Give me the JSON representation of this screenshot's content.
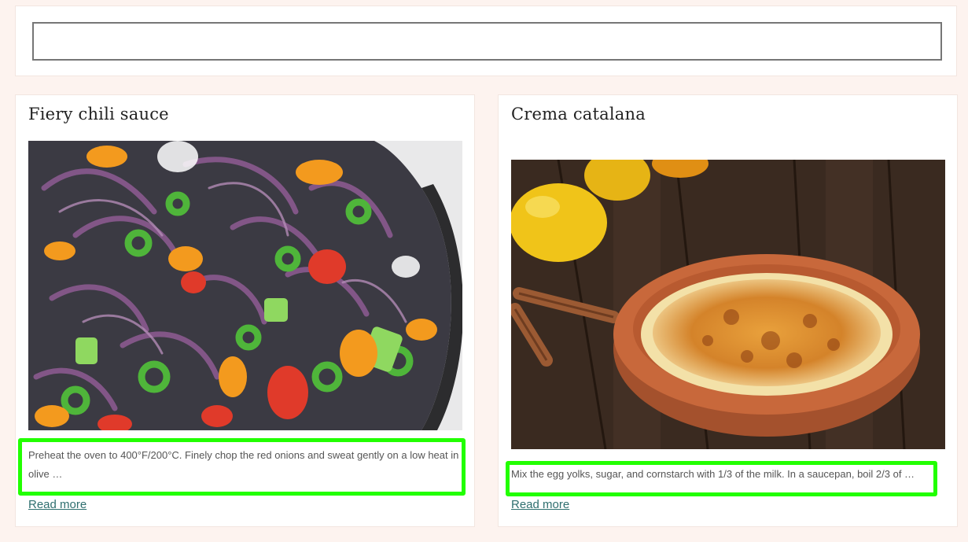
{
  "search": {
    "value": "",
    "placeholder": ""
  },
  "recipes": [
    {
      "title": "Fiery chili sauce",
      "image": "chili-sauce-photo",
      "excerpt": "Preheat the oven to 400°F/200°C. Finely chop the red onions and sweat gently on a low heat in olive …",
      "read_more": "Read more"
    },
    {
      "title": "Crema catalana",
      "image": "crema-catalana-photo",
      "excerpt": "Mix the egg yolks, sugar, and cornstarch with 1/3 of the milk. In a saucepan, boil 2/3 of …",
      "read_more": "Read more"
    }
  ],
  "colors": {
    "background": "#fdf3ef",
    "link": "#2f6f6f",
    "highlight": "#22ff00"
  }
}
